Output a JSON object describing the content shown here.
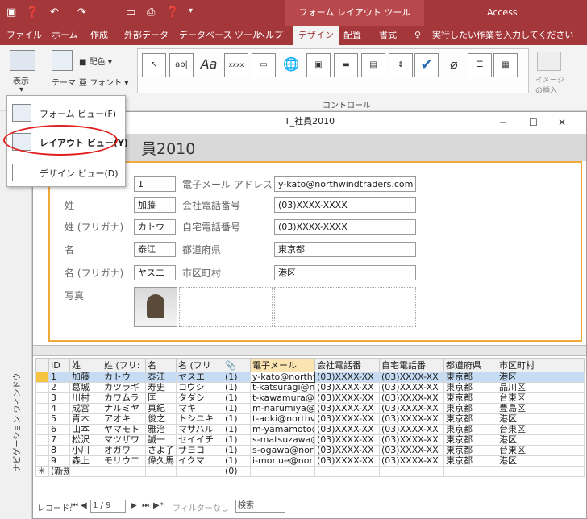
{
  "titlebar": {
    "quick_icons": [
      "save-icon",
      "help-icon",
      "undo-icon",
      "redo-icon",
      "open-icon",
      "print-preview-icon",
      "help-icon-2",
      "customize-icon"
    ],
    "context_title": "フォーム レイアウト ツール",
    "app_title": "Access"
  },
  "tabs": [
    "ファイル",
    "ホーム",
    "作成",
    "外部データ",
    "データベース ツール",
    "ヘルプ",
    "デザイン",
    "配置",
    "書式"
  ],
  "tell_me": "実行したい作業を入力してください",
  "ribbon": {
    "view": "表示",
    "theme": "テーマ",
    "color": "配色",
    "font": "フォント",
    "controls_group": "コントロール",
    "image_insert": "イメージ\nの挿入"
  },
  "dropdown": {
    "items": [
      "フォーム ビュー(F)",
      "レイアウト ビュー(Y)",
      "デザイン ビュー(D)"
    ]
  },
  "window": {
    "title": "T_社員2010",
    "form_title": "員2010"
  },
  "form": {
    "labels": {
      "id": "ID",
      "email": "電子メール アドレス",
      "last": "姓",
      "work_phone": "会社電話番号",
      "last_kana": "姓 (フリガナ)",
      "home_phone": "自宅電話番号",
      "first": "名",
      "pref": "都道府県",
      "first_kana": "名 (フリガナ)",
      "city": "市区町村",
      "photo": "写真"
    },
    "values": {
      "id": "1",
      "email": "y-kato@northwindtraders.com",
      "last": "加藤",
      "work_phone": "(03)XXXX-XXXX",
      "last_kana": "カトウ",
      "home_phone": "(03)XXXX-XXXX",
      "first": "泰江",
      "pref": "東京都",
      "first_kana": "ヤスエ",
      "city": "港区"
    }
  },
  "grid": {
    "headers": [
      "ID",
      "姓",
      "姓 (フリ:",
      "名",
      "名 (フリ",
      "📎",
      "電子メール",
      "会社電話番",
      "自宅電話番",
      "都道府県",
      "市区町村"
    ],
    "rows": [
      [
        "1",
        "加藤",
        "カトウ",
        "泰江",
        "ヤスエ",
        "(1)",
        "y-kato@northw",
        "(03)XXXX-XX",
        "(03)XXXX-XX",
        "東京都",
        "港区"
      ],
      [
        "2",
        "葛城",
        "カツラギ",
        "寿史",
        "コウシ",
        "(1)",
        "t-katsuragi@n",
        "(03)XXXX-XX",
        "(03)XXXX-XX",
        "東京都",
        "品川区"
      ],
      [
        "3",
        "川村",
        "カワムラ",
        "匡",
        "タダシ",
        "(1)",
        "t-kawamura@r",
        "(03)XXXX-XX",
        "(03)XXXX-XX",
        "東京都",
        "台東区"
      ],
      [
        "4",
        "成宮",
        "ナルミヤ",
        "真紀",
        "マキ",
        "(1)",
        "m-narumiya@r",
        "(03)XXXX-XX",
        "(03)XXXX-XX",
        "東京都",
        "豊島区"
      ],
      [
        "5",
        "青木",
        "アオキ",
        "俊之",
        "トシユキ",
        "(1)",
        "t-aoki@northv",
        "(03)XXXX-XX",
        "(03)XXXX-XX",
        "東京都",
        "港区"
      ],
      [
        "6",
        "山本",
        "ヤマモト",
        "雅治",
        "マサハル",
        "(1)",
        "m-yamamoto@",
        "(03)XXXX-XX",
        "(03)XXXX-XX",
        "東京都",
        "台東区"
      ],
      [
        "7",
        "松沢",
        "マツザワ",
        "誠一",
        "セイイチ",
        "(1)",
        "s-matsuzawa@",
        "(03)XXXX-XX",
        "(03)XXXX-XX",
        "東京都",
        "港区"
      ],
      [
        "8",
        "小川",
        "オガワ",
        "さよ子",
        "サヨコ",
        "(1)",
        "s-ogawa@nortl",
        "(03)XXXX-XX",
        "(03)XXXX-XX",
        "東京都",
        "台東区"
      ],
      [
        "9",
        "森上",
        "モリウエ",
        "偉久馬",
        "イクマ",
        "(1)",
        "i-moriue@nort",
        "(03)XXXX-XX",
        "(03)XXXX-XX",
        "東京都",
        "港区"
      ]
    ],
    "new_row": "(新規",
    "new_attach": "(0)"
  },
  "recnav": {
    "label": "レコード:",
    "first": "⏮",
    "prev": "◀",
    "current": "1 / 9",
    "next": "▶",
    "last": "⏭",
    "new": "▶*",
    "filter": "フィルターなし",
    "search": "検索"
  },
  "nav_pane": "ナビゲーション ウィンドウ"
}
